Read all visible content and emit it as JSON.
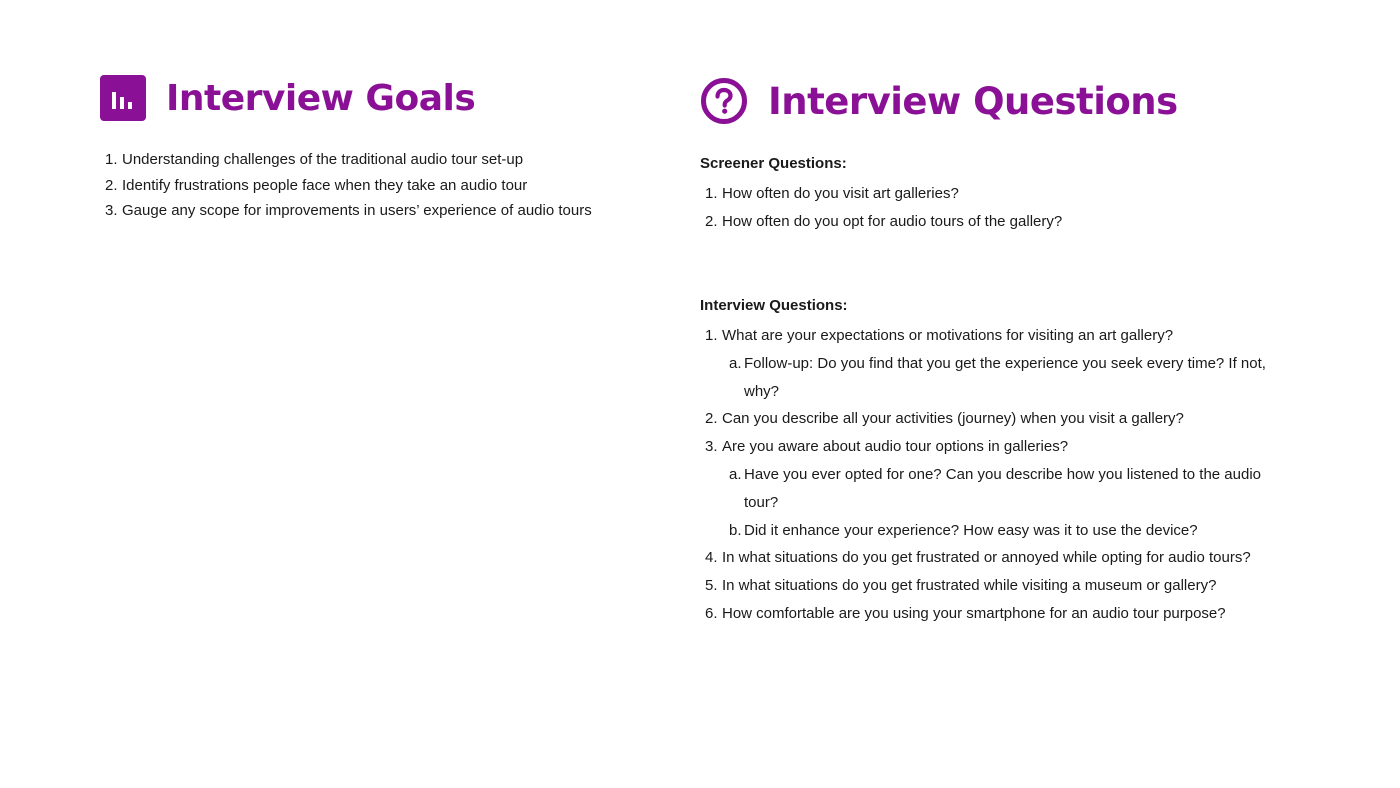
{
  "goals_section": {
    "title": "Interview Goals",
    "icon": "bar-chart-icon",
    "items": [
      {
        "marker": "1.",
        "text": "Understanding challenges of the traditional audio tour set-up"
      },
      {
        "marker": "2.",
        "text": "Identify frustrations people face when they take an audio tour"
      },
      {
        "marker": "3.",
        "text": "Gauge any scope for improvements in users’ experience of audio tours"
      }
    ]
  },
  "questions_section": {
    "title": "Interview Questions",
    "icon": "question-circle-icon",
    "screener": {
      "title": "Screener Questions:",
      "items": [
        {
          "marker": "1.",
          "text": "How often do you visit art galleries?"
        },
        {
          "marker": "2.",
          "text": "How often do you opt for audio tours of the gallery?"
        }
      ]
    },
    "interview": {
      "title": "Interview Questions:",
      "items": [
        {
          "marker": "1.",
          "text": "What are your expectations or motivations for visiting an art gallery?"
        },
        {
          "marker": "a.",
          "text": "Follow-up: Do you find that you get the experience you seek every time? If not, why?"
        },
        {
          "marker": "2.",
          "text": "Can you describe all your activities (journey) when you visit a gallery?"
        },
        {
          "marker": "3.",
          "text": "Are you aware about audio tour options in galleries?"
        },
        {
          "marker": "a.",
          "text": "Have you ever opted for one? Can you describe how you listened to the audio tour?"
        },
        {
          "marker": "b.",
          "text": "Did it enhance your experience? How easy was it to use the device?"
        },
        {
          "marker": "4.",
          "text": "In what situations do you get frustrated or annoyed while opting for audio tours?"
        },
        {
          "marker": "5.",
          "text": "In what situations do you get frustrated while visiting a museum or gallery?"
        },
        {
          "marker": "6.",
          "text": "How comfortable are you using your smartphone for an audio tour purpose?"
        }
      ]
    }
  },
  "colors": {
    "accent": "#8a1196",
    "text": "#1a1a1a"
  }
}
